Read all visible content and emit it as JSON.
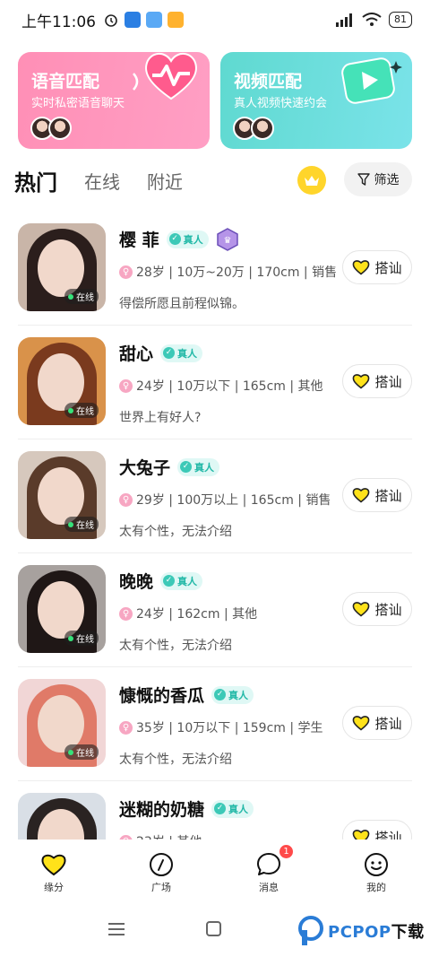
{
  "status_bar": {
    "time": "上午11:06",
    "battery": "81"
  },
  "banners": {
    "voice": {
      "title": "语音匹配",
      "subtitle": "实时私密语音聊天",
      "color": "#ff8fb6"
    },
    "video": {
      "title": "视频匹配",
      "subtitle": "真人视频快速约会",
      "color": "#5fd9d0"
    }
  },
  "tabs": {
    "items": [
      {
        "label": "热门",
        "active": true
      },
      {
        "label": "在线",
        "active": false
      },
      {
        "label": "附近",
        "active": false
      }
    ],
    "filter_label": "筛选"
  },
  "feed": {
    "online_label": "在线",
    "verified_label": "真人",
    "greet_label": "搭讪",
    "users": [
      {
        "name": "樱 菲",
        "info": "28岁 | 10万~20万 | 170cm | 销售",
        "bio": "得偿所愿且前程似锦。",
        "online": true,
        "rank_badge": true,
        "hair": "#2b1e1c"
      },
      {
        "name": "甜心",
        "info": "24岁 | 10万以下 | 165cm | 其他",
        "bio": "世界上有好人?",
        "online": true,
        "rank_badge": false,
        "hair": "#7a3a1e"
      },
      {
        "name": "大兔子",
        "info": "29岁 | 100万以上 | 165cm | 销售",
        "bio": "太有个性，无法介绍",
        "online": true,
        "rank_badge": false,
        "hair": "#5a3b2a"
      },
      {
        "name": "晚晚",
        "info": "24岁 | 162cm | 其他",
        "bio": "太有个性，无法介绍",
        "online": true,
        "rank_badge": false,
        "hair": "#1f1716"
      },
      {
        "name": "慷慨的香瓜",
        "info": "35岁 | 10万以下 | 159cm | 学生",
        "bio": "太有个性，无法介绍",
        "online": true,
        "rank_badge": false,
        "hair": "#e07a68"
      },
      {
        "name": "迷糊的奶糖",
        "info": "23岁 | 其他",
        "bio": "",
        "online": false,
        "rank_badge": false,
        "hair": "#2a2322"
      }
    ]
  },
  "bottom_nav": {
    "items": [
      {
        "label": "缘分",
        "icon": "heart-icon",
        "active": true
      },
      {
        "label": "广场",
        "icon": "compass-icon",
        "active": false
      },
      {
        "label": "消息",
        "icon": "chat-bubble-icon",
        "active": false,
        "badge": "1"
      },
      {
        "label": "我的",
        "icon": "smile-face-icon",
        "active": false
      }
    ]
  },
  "watermark": {
    "brand": "PCPOP",
    "suffix": "下载"
  },
  "colors": {
    "accent_yellow": "#ffe21a",
    "verified_teal": "#3cc9b7",
    "online_green": "#36e27a"
  }
}
